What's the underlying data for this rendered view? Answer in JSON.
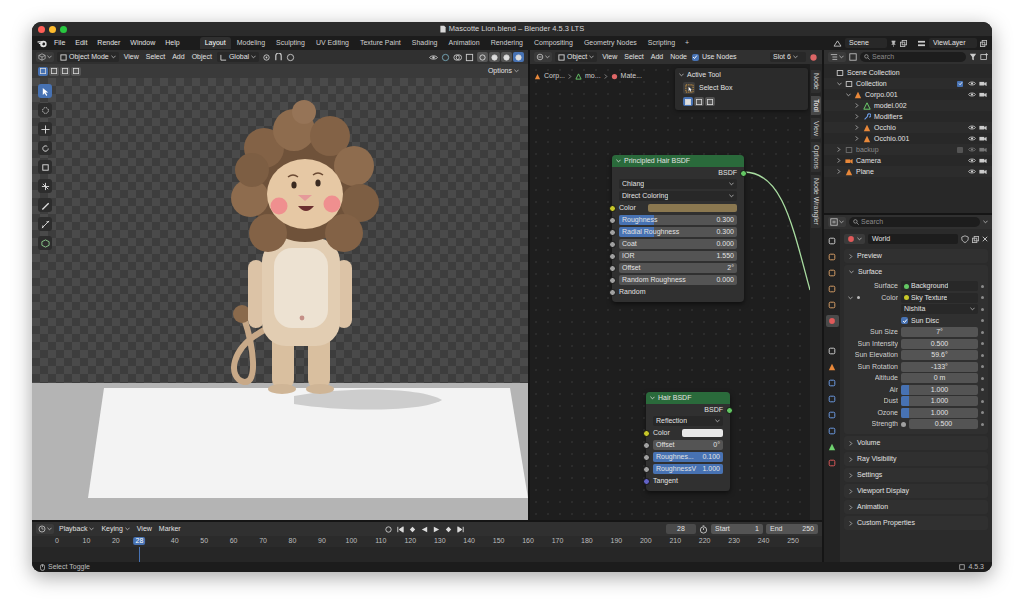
{
  "window": {
    "title": "Mascotte Lion.blend – Blender 4.5.3 LTS"
  },
  "topbar": {
    "menu": [
      "File",
      "Edit",
      "Render",
      "Window",
      "Help"
    ],
    "workspaces": [
      {
        "label": "Layout",
        "selected": true
      },
      {
        "label": "Modeling",
        "selected": false
      },
      {
        "label": "Sculpting",
        "selected": false
      },
      {
        "label": "UV Editing",
        "selected": false
      },
      {
        "label": "Texture Paint",
        "selected": false
      },
      {
        "label": "Shading",
        "selected": false
      },
      {
        "label": "Animation",
        "selected": false
      },
      {
        "label": "Rendering",
        "selected": false
      },
      {
        "label": "Compositing",
        "selected": false
      },
      {
        "label": "Geometry Nodes",
        "selected": false
      },
      {
        "label": "Scripting",
        "selected": false
      }
    ],
    "add_workspace": "+",
    "scene": "Scene",
    "view_layer": "ViewLayer"
  },
  "viewport": {
    "mode": "Object Mode",
    "menus": [
      "View",
      "Select",
      "Add",
      "Object"
    ],
    "orientation": "Global",
    "options": "Options",
    "select_modes": [
      {
        "selected": true
      },
      {
        "selected": false
      },
      {
        "selected": false
      },
      {
        "selected": false
      }
    ],
    "shading_modes": [
      {
        "selected": false
      },
      {
        "selected": false
      },
      {
        "selected": false
      },
      {
        "selected": true
      }
    ],
    "tools": [
      {
        "selected": true
      },
      {
        "selected": false
      },
      {
        "selected": false
      },
      {
        "selected": false
      },
      {
        "selected": false
      },
      {
        "selected": false
      },
      {
        "selected": false
      },
      {
        "selected": false
      },
      {
        "selected": false
      }
    ]
  },
  "node_editor": {
    "type": "Object",
    "menus": [
      "View",
      "Select",
      "Add",
      "Node"
    ],
    "use_nodes": {
      "label": "Use Nodes",
      "checked": true
    },
    "slot": "Slot 6",
    "breadcrumb": [
      "Corp...",
      "mo...",
      "Mate..."
    ],
    "active_tool": {
      "title": "Active Tool",
      "tool": "Select Box",
      "modes": [
        {
          "selected": true
        },
        {
          "selected": false
        },
        {
          "selected": false
        }
      ]
    },
    "side_tabs": [
      {
        "label": "Node",
        "selected": false
      },
      {
        "label": "Tool",
        "selected": true
      },
      {
        "label": "View",
        "selected": false
      },
      {
        "label": "Options",
        "selected": false
      },
      {
        "label": "Node Wrangler",
        "selected": false
      }
    ],
    "nodes": [
      {
        "title": "Principled Hair BSDF",
        "output": "BSDF",
        "output_color": "#63c763",
        "rows": [
          {
            "kind": "dropdown",
            "value": "Chiang"
          },
          {
            "kind": "dropdown",
            "value": "Direct Coloring"
          },
          {
            "kind": "color",
            "label": "Color",
            "swatch": "#8b7850",
            "color": "#c7c729"
          },
          {
            "kind": "slider",
            "label": "Roughness",
            "value": "0.300",
            "level": 0.3,
            "color": "#a1a1a1"
          },
          {
            "kind": "slider",
            "label": "Radial Roughness",
            "value": "0.300",
            "level": 0.3,
            "color": "#a1a1a1"
          },
          {
            "kind": "slider",
            "label": "Coat",
            "value": "0.000",
            "level": 0,
            "color": "#a1a1a1"
          },
          {
            "kind": "number",
            "label": "IOR",
            "value": "1.550",
            "color": "#a1a1a1"
          },
          {
            "kind": "number",
            "label": "Offset",
            "value": "2°",
            "color": "#a1a1a1"
          },
          {
            "kind": "slider",
            "label": "Random Roughness",
            "value": "0.000",
            "level": 0,
            "color": "#a1a1a1"
          },
          {
            "kind": "socket",
            "label": "Random",
            "color": "#a1a1a1"
          }
        ]
      },
      {
        "title": "Hair BSDF",
        "output": "BSDF",
        "output_color": "#63c763",
        "rows": [
          {
            "kind": "dropdown",
            "value": "Reflection"
          },
          {
            "kind": "color",
            "label": "Color",
            "swatch": "#e8e8e8",
            "color": "#c7c729"
          },
          {
            "kind": "number",
            "label": "Offset",
            "value": "0°",
            "color": "#a1a1a1"
          },
          {
            "kind": "slider",
            "label": "Roughnes...",
            "value": "0.100",
            "level": 1,
            "color": "#a1a1a1"
          },
          {
            "kind": "slider",
            "label": "RoughnessV",
            "value": "1.000",
            "level": 1,
            "color": "#a1a1a1"
          },
          {
            "kind": "socket",
            "label": "Tangent",
            "color": "#6363c7"
          }
        ]
      }
    ]
  },
  "outliner": {
    "search_placeholder": "Search",
    "items": [
      {
        "name": "Scene Collection",
        "kind": "scene",
        "toggles": false,
        "disabled": false,
        "children": [
          {
            "name": "Collection",
            "kind": "collection",
            "expanded": true,
            "checked": true,
            "toggles": true,
            "disabled": false,
            "children": [
              {
                "name": "Corpo.001",
                "kind": "object",
                "expanded": true,
                "toggles": true,
                "disabled": false,
                "children": [
                  {
                    "name": "model.002",
                    "kind": "mesh",
                    "expanded": false,
                    "toggles": false,
                    "disabled": false
                  },
                  {
                    "name": "Modifiers",
                    "kind": "modifiers",
                    "expanded": false,
                    "toggles": false,
                    "disabled": false
                  },
                  {
                    "name": "Occhio",
                    "kind": "object",
                    "expanded": false,
                    "toggles": true,
                    "disabled": false
                  },
                  {
                    "name": "Occhio.001",
                    "kind": "object",
                    "expanded": false,
                    "toggles": true,
                    "disabled": false
                  }
                ]
              }
            ]
          },
          {
            "name": "backup",
            "kind": "collection",
            "expanded": false,
            "checked": false,
            "toggles": true,
            "disabled": true
          },
          {
            "name": "Camera",
            "kind": "camera",
            "expanded": false,
            "toggles": true,
            "disabled": false
          },
          {
            "name": "Plane",
            "kind": "object",
            "expanded": false,
            "toggles": true,
            "disabled": false
          }
        ]
      }
    ]
  },
  "properties": {
    "search_placeholder": "Search",
    "world": "World",
    "tabs": [
      {
        "selected": false
      },
      {
        "selected": false
      },
      {
        "selected": false
      },
      {
        "selected": false
      },
      {
        "selected": false
      },
      {
        "selected": true
      },
      {
        "selected": false
      },
      {
        "selected": false
      },
      {
        "selected": false
      },
      {
        "selected": false
      },
      {
        "selected": false
      },
      {
        "selected": false
      },
      {
        "selected": false
      },
      {
        "selected": false
      }
    ],
    "sections": [
      {
        "label": "Preview",
        "expanded": false,
        "rows": []
      },
      {
        "label": "Surface",
        "expanded": true,
        "rows": [
          {
            "kind": "link",
            "label": "Surface",
            "value": "Background",
            "color": "#63c763"
          },
          {
            "kind": "link",
            "label": "Color",
            "value": "Sky Texture",
            "color": "#c7c729",
            "expanded": true
          },
          {
            "kind": "dropdown",
            "value": "Nishita"
          },
          {
            "kind": "checkbox",
            "label": "Sun Disc",
            "checked": true
          },
          {
            "kind": "number",
            "label": "Sun Size",
            "value": "7°"
          },
          {
            "kind": "number",
            "label": "Sun Intensity",
            "value": "0.500"
          },
          {
            "kind": "number",
            "label": "Sun Elevation",
            "value": "59.6°"
          },
          {
            "kind": "number",
            "label": "Sun Rotation",
            "value": "-133°"
          },
          {
            "kind": "number",
            "label": "Altitude",
            "value": "0 m"
          },
          {
            "kind": "slider",
            "label": "Air",
            "value": "1.000",
            "level": 0.1
          },
          {
            "kind": "slider",
            "label": "Dust",
            "value": "1.000",
            "level": 0.1
          },
          {
            "kind": "slider",
            "label": "Ozone",
            "value": "1.000",
            "level": 0.1
          },
          {
            "kind": "number",
            "label": "Strength",
            "value": "0.500",
            "color": "#a1a1a1"
          }
        ]
      },
      {
        "label": "Volume",
        "expanded": false,
        "rows": []
      },
      {
        "label": "Ray Visibility",
        "expanded": false,
        "rows": []
      },
      {
        "label": "Settings",
        "expanded": false,
        "rows": []
      },
      {
        "label": "Viewport Display",
        "expanded": false,
        "rows": []
      },
      {
        "label": "Animation",
        "expanded": false,
        "rows": []
      },
      {
        "label": "Custom Properties",
        "expanded": false,
        "rows": []
      }
    ]
  },
  "timeline": {
    "menus": [
      {
        "label": "Playback",
        "dropdown": true
      },
      {
        "label": "Keying",
        "dropdown": true
      },
      {
        "label": "View",
        "dropdown": false
      },
      {
        "label": "Marker",
        "dropdown": false
      }
    ],
    "current_frame": "28",
    "start": {
      "label": "Start",
      "value": "1"
    },
    "end": {
      "label": "End",
      "value": "250"
    },
    "ticks": [
      "0",
      "10",
      "20",
      "28",
      "40",
      "50",
      "60",
      "70",
      "80",
      "90",
      "100",
      "110",
      "120",
      "130",
      "140",
      "150",
      "160",
      "170",
      "180",
      "190",
      "200",
      "210",
      "220",
      "230",
      "240",
      "250"
    ]
  },
  "status_bar": {
    "hint": "Select Toggle",
    "version": "4.5.3"
  }
}
